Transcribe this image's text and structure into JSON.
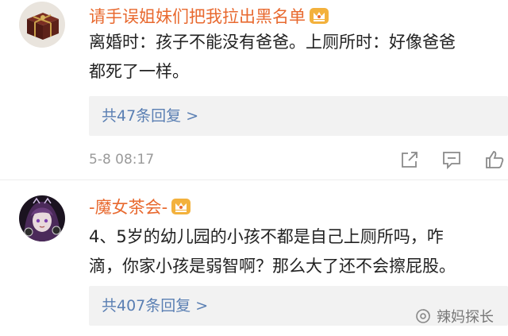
{
  "comments": [
    {
      "username": "请手误姐妹们把我拉出黑名单",
      "text_line1": "离婚时：孩子不能没有爸爸。上厕所时：好像爸爸",
      "text_line2": "都死了一样。",
      "replies": "共47条回复 >",
      "timestamp": "5-8 08:17",
      "avatar_icon": "gift-box-avatar",
      "badge_icon": "vip-crown-icon"
    },
    {
      "username": "-魔女茶会-",
      "text_line1": "4、5岁的幼儿园的小孩不都是自己上厕所吗，咋",
      "text_line2": "滴，你家小孩是弱智啊？那么大了还不会擦屁股。",
      "replies": "共407条回复 >",
      "avatar_icon": "anime-girl-avatar",
      "badge_icon": "vip-crown-icon"
    }
  ],
  "actions": [
    "share-icon",
    "comment-icon",
    "like-icon"
  ],
  "watermark": {
    "text": "辣妈探长",
    "icon": "wechat-official-account-icon"
  },
  "colors": {
    "username": "#e8692f",
    "reply_link": "#5a7fb3",
    "reply_bg": "#f2f2f2",
    "meta": "#9a9a9a"
  }
}
